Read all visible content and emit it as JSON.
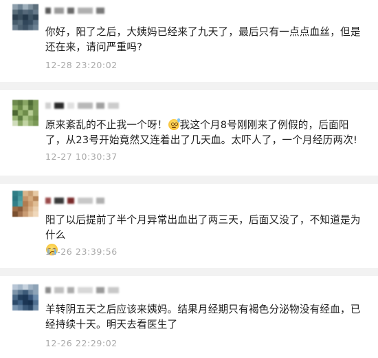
{
  "comments": [
    {
      "text_parts": [
        "你好，阳了之后，大姨妈已经来了九天了，最后只有一点点血丝，但是还在来，请问严重吗?"
      ],
      "time": "12-28 23:20:02",
      "avatar_colors": [
        "#8fa0ad",
        "#6f8494",
        "#9fb0bc",
        "#7d8f9c",
        "#5d6f7c",
        "#5a6d7a",
        "#3f5566",
        "#56697a",
        "#4a6072",
        "#66798a",
        "#2d3f4f",
        "#3a4e5e",
        "#24384a",
        "#405566",
        "#2f4354",
        "#475c6c",
        "#556a7a",
        "#30465a",
        "#384e62",
        "#5a7083",
        "#6b7e8e",
        "#4b6071",
        "#3b5063",
        "#52687b",
        "#6b8092"
      ],
      "name_colors": [
        "#5a5a5a",
        "#9a9a9a",
        "#6a6a6a",
        "#b0b0b0",
        "#7a7a7a"
      ]
    },
    {
      "text_parts": [
        "原来紊乱的不止我一个呀！",
        "我这个月8号刚刚来了例假的，后面阳了，从23号开始竟然又连着出了几天血。太吓人了，一个月经历两次!"
      ],
      "time": "12-27 10:30:37",
      "emoji": "sweat-smile-emoji",
      "avatar_colors": [
        "#6e8a4e",
        "#5d7a3f",
        "#88a564",
        "#4e6b35",
        "#7c9a58",
        "#90ae6a",
        "#6a8a48",
        "#a4bf80",
        "#5c7a3e",
        "#7f9d5b",
        "#4d6833",
        "#8fad68",
        "#6e8c4a",
        "#b7cc94",
        "#7a9856",
        "#9ab676",
        "#5e7d41",
        "#a8c383",
        "#82a05e",
        "#6b8a47",
        "#d0dcbc",
        "#8aa866",
        "#c2d4a4",
        "#94b070",
        "#7b9957"
      ],
      "name_colors": [
        "#d0d0d0",
        "#2a2a2a",
        "#e0e0e0",
        "#b8b8b8",
        "#a0a0a0",
        "#cccccc"
      ]
    },
    {
      "text_parts": [
        "阳了以后提前了半个月异常出血出了两三天，后面又没了，不知道是为什么"
      ],
      "time": "12-26 23:39:56",
      "emoji": "crying-emoji",
      "avatar_colors": [
        "#2f7e86",
        "#3d8f96",
        "#d9b48a",
        "#c89e72",
        "#e6c9a4",
        "#2a7680",
        "#4a9ba0",
        "#c49468",
        "#d6ad80",
        "#b68558",
        "#337f88",
        "#5aa6a8",
        "#b07c50",
        "#cc9d70",
        "#e0bd94",
        "#9c6b45",
        "#8a5b3a",
        "#b88a60",
        "#d8b088",
        "#eacfae",
        "#7a5030",
        "#a37450",
        "#c99c74",
        "#e2c19c",
        "#f0d8bb"
      ],
      "name_colors": [
        "#9a4a4a",
        "#3a3a3a",
        "#7a2a2a",
        "#c8c8c8",
        "#b0b0b0"
      ]
    },
    {
      "text_parts": [
        "羊转阴五天之后应该来姨妈。结果月经期只有褐色分泌物没有经血，已经持续十天。明天去看医生了"
      ],
      "time": "12-26 22:29:02",
      "avatar_colors": [
        "#b8c6d6",
        "#a4b6c8",
        "#c6d2de",
        "#9fb1c3",
        "#8da2b6",
        "#7e95aa",
        "#5a7690",
        "#3c5a78",
        "#6f88a0",
        "#8ea4b8",
        "#4a6886",
        "#233f5e",
        "#1d3857",
        "#37557a",
        "#6a8aaa",
        "#2c4a6a",
        "#3d5f82",
        "#1b3554",
        "#16304e",
        "#4f6f90",
        "#7894b0",
        "#5f7d9c",
        "#3a5878",
        "#2a4766",
        "#6d8aa6"
      ],
      "name_colors": [
        "#8a8a8a",
        "#c0c0c0",
        "#aaaaaa",
        "#d8d8d8",
        "#9a9a9a",
        "#c8c8c8"
      ]
    }
  ],
  "colors": {
    "text": "#1e1e1e",
    "timestamp": "#a9a9a9",
    "divider": "#f2f2f2"
  }
}
